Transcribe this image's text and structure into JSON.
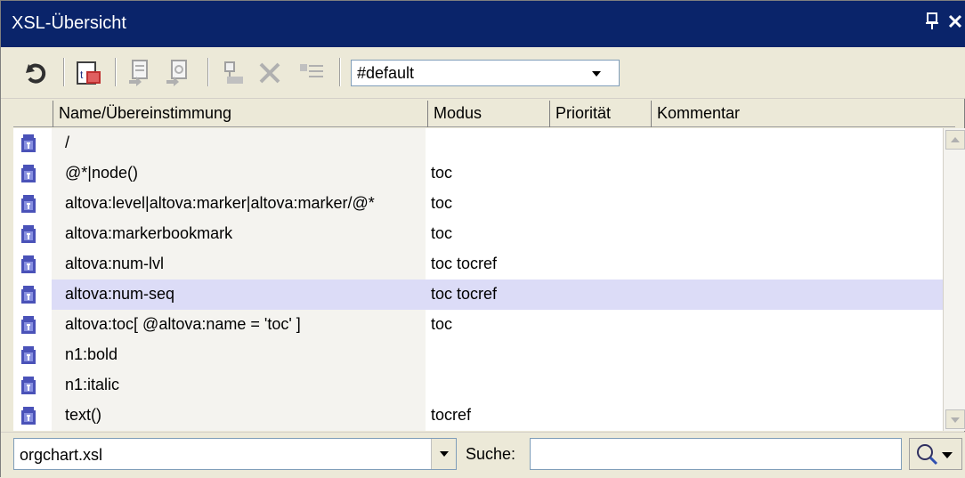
{
  "window": {
    "title": "XSL-Übersicht",
    "pin_icon": "pin-icon",
    "close_icon": "close-icon",
    "pin_glyph": "ᵖ",
    "close_glyph": "✕"
  },
  "toolbar": {
    "buttons": [
      {
        "name": "sync-icon"
      },
      {
        "name": "xslt-template-icon"
      },
      {
        "name": "insert-template-icon"
      },
      {
        "name": "insert-function-icon"
      },
      {
        "name": "move-to-icon"
      },
      {
        "name": "delete-icon"
      },
      {
        "name": "list-icon"
      }
    ],
    "mode_select_value": "#default"
  },
  "columns": {
    "name": "Name/Übereinstimmung",
    "mode": "Modus",
    "priority": "Priorität",
    "comment": "Kommentar"
  },
  "rows": [
    {
      "name": "/",
      "mode": ""
    },
    {
      "name": "@*|node()",
      "mode": "toc"
    },
    {
      "name": "altova:level|altova:marker|altova:marker/@*",
      "mode": "toc"
    },
    {
      "name": "altova:markerbookmark",
      "mode": "toc"
    },
    {
      "name": "altova:num-lvl",
      "mode": "toc tocref"
    },
    {
      "name": "altova:num-seq",
      "mode": "toc tocref"
    },
    {
      "name": "altova:toc[ @altova:name = 'toc' ]",
      "mode": "toc"
    },
    {
      "name": "n1:bold",
      "mode": ""
    },
    {
      "name": "n1:italic",
      "mode": ""
    },
    {
      "name": "text()",
      "mode": "tocref"
    }
  ],
  "selected_row_index": 5,
  "bottom": {
    "file_select_value": "orgchart.xsl",
    "search_label": "Suche:",
    "search_value": ""
  },
  "colors": {
    "titlebar": "#0a246a",
    "selection": "#dcdcf7",
    "template_icon": "#4a52b8"
  }
}
